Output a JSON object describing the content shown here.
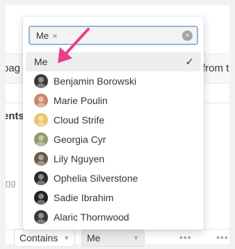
{
  "background": {
    "text_pag": "pag",
    "text_from": "from t",
    "text_ents": "ents",
    "text_ing": "ing"
  },
  "filter_bar": {
    "operator": "Contains",
    "value": "Me",
    "more": "•••"
  },
  "dropdown": {
    "search": {
      "token": "Me",
      "token_remove": "×",
      "placeholder": "",
      "value": "",
      "clear": "×"
    },
    "options": [
      {
        "label": "Me",
        "selected": true,
        "check": "✓"
      },
      {
        "label": "Benjamin Borowski",
        "avatar_color": "#3d3a35"
      },
      {
        "label": "Marie Poulin",
        "avatar_color": "#c9876a"
      },
      {
        "label": "Cloud Strife",
        "avatar_color": "#e8c46d"
      },
      {
        "label": "Georgia Cyr",
        "avatar_color": "#8f9a6e"
      },
      {
        "label": "Lily Nguyen",
        "avatar_color": "#6d5a4c"
      },
      {
        "label": "Ophelia Silverstone",
        "avatar_color": "#2d2b29"
      },
      {
        "label": "Sadie Ibrahim",
        "avatar_color": "#24211f"
      },
      {
        "label": "Alaric Thornwood",
        "avatar_color": "#3a3836"
      }
    ]
  },
  "colors": {
    "focus_border": "#90b6dd",
    "annotation_arrow": "#ec3c8d",
    "selected_row": "#eeeeed"
  }
}
